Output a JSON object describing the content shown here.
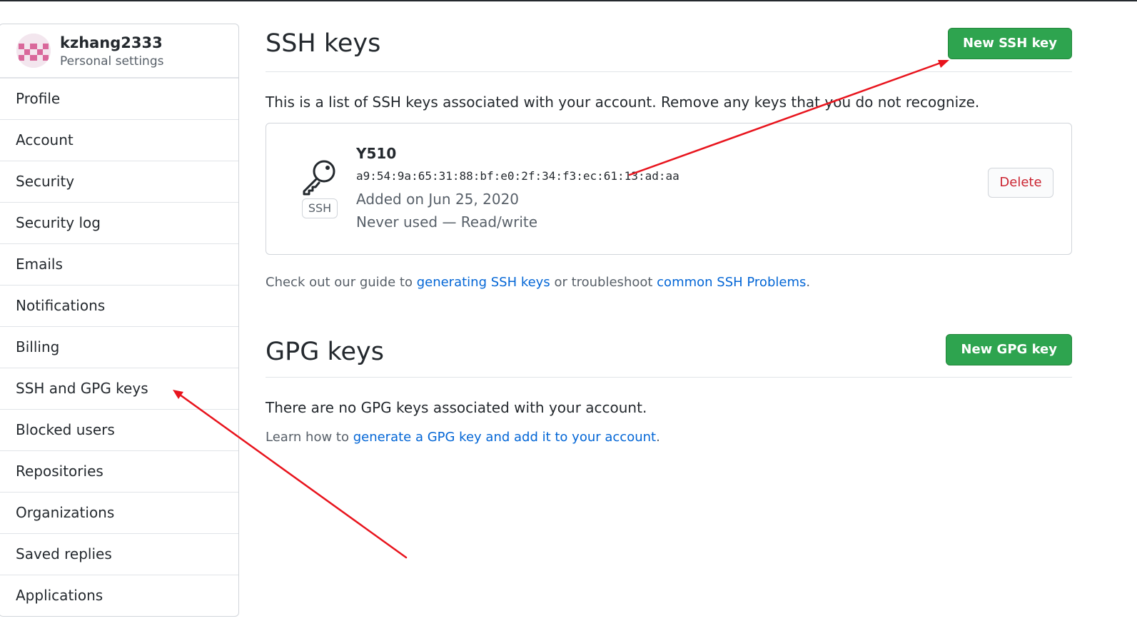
{
  "sidebar": {
    "username": "kzhang2333",
    "subtitle": "Personal settings",
    "items": [
      {
        "label": "Profile"
      },
      {
        "label": "Account"
      },
      {
        "label": "Security"
      },
      {
        "label": "Security log"
      },
      {
        "label": "Emails"
      },
      {
        "label": "Notifications"
      },
      {
        "label": "Billing"
      },
      {
        "label": "SSH and GPG keys"
      },
      {
        "label": "Blocked users"
      },
      {
        "label": "Repositories"
      },
      {
        "label": "Organizations"
      },
      {
        "label": "Saved replies"
      },
      {
        "label": "Applications"
      }
    ]
  },
  "ssh": {
    "title": "SSH keys",
    "new_button": "New SSH key",
    "intro": "This is a list of SSH keys associated with your account. Remove any keys that you do not recognize.",
    "key": {
      "name": "Y510",
      "fingerprint": "a9:54:9a:65:31:88:bf:e0:2f:34:f3:ec:61:13:ad:aa",
      "added": "Added on Jun 25, 2020",
      "usage": "Never used — Read/write",
      "badge": "SSH",
      "delete_label": "Delete"
    },
    "guide": {
      "prefix": "Check out our guide to ",
      "link1": "generating SSH keys",
      "middle": " or troubleshoot ",
      "link2": "common SSH Problems",
      "suffix": "."
    }
  },
  "gpg": {
    "title": "GPG keys",
    "new_button": "New GPG key",
    "none_text": "There are no GPG keys associated with your account.",
    "learn": {
      "prefix": "Learn how to ",
      "link": "generate a GPG key and add it to your account",
      "suffix": "."
    }
  },
  "colors": {
    "green_button": "#2ea44f",
    "link": "#0366d6",
    "danger": "#cb2431",
    "annotation_arrow": "#e8141d"
  }
}
